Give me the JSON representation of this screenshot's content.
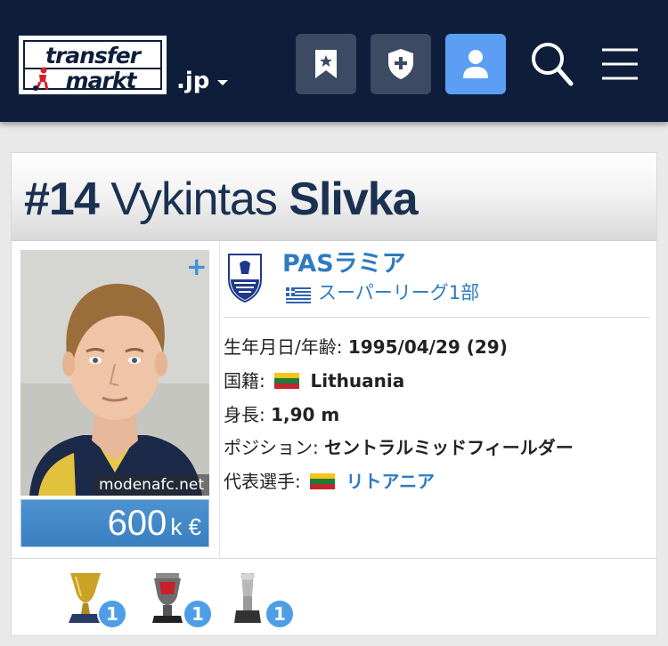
{
  "header": {
    "logo_line1": "transfer",
    "logo_line2": "markt",
    "domain": ".jp",
    "icons": [
      "bookmark-star-icon",
      "shield-plus-icon",
      "user-icon",
      "search-icon",
      "menu-icon"
    ]
  },
  "player": {
    "number": "#14",
    "first_name": "Vykintas",
    "last_name": "Slivka",
    "photo_credit": "modenafc.net",
    "market_value": "600",
    "market_value_unit": "k €"
  },
  "club": {
    "name": "PASラミア",
    "league": "スーパーリーグ1部"
  },
  "info": {
    "birth_label": "生年月日/年齢:",
    "birth_value": "1995/04/29 (29)",
    "nationality_label": "国籍:",
    "nationality_value": "Lithuania",
    "height_label": "身長:",
    "height_value": "1,90 m",
    "position_label": "ポジション:",
    "position_value": "セントラルミッドフィールダー",
    "national_label": "代表選手:",
    "national_value": "リトアニア"
  },
  "trophies": [
    {
      "count": "1",
      "icon": "trophy-gold-icon"
    },
    {
      "count": "1",
      "icon": "trophy-red-icon"
    },
    {
      "count": "1",
      "icon": "trophy-silver-icon"
    }
  ],
  "colors": {
    "header_bg": "#0e1e3a",
    "button_bg": "#3c4a64",
    "active_button_bg": "#5b9ef4",
    "link": "#2e7bc1",
    "title": "#1a3151"
  }
}
